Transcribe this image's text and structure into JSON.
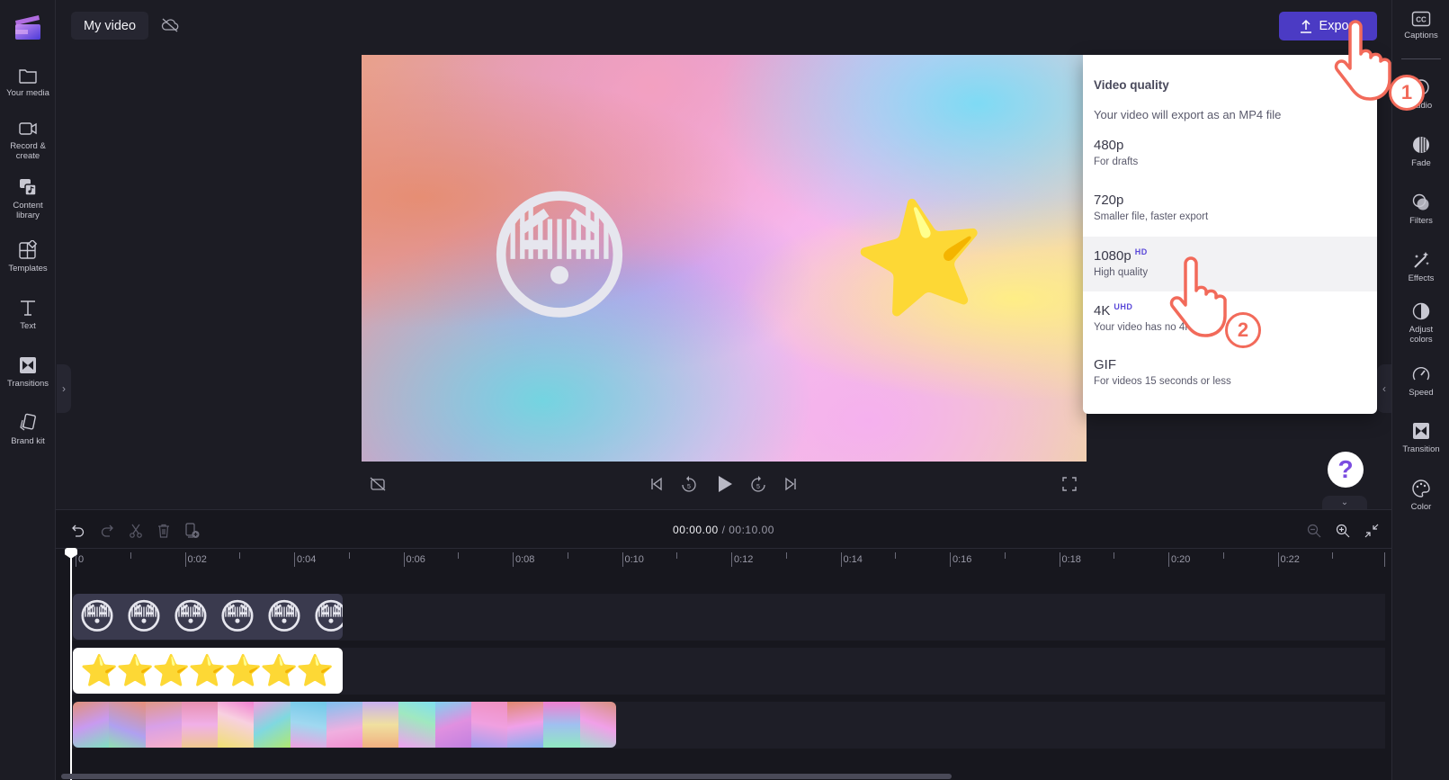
{
  "app": {
    "project_title": "My video",
    "cloud_status_icon": "cloud-off-icon"
  },
  "left_sidebar": {
    "items": [
      {
        "label": "Your media",
        "icon": "folder-icon"
      },
      {
        "label": "Record &\ncreate",
        "icon": "video-camera-icon"
      },
      {
        "label": "Content\nlibrary",
        "icon": "content-library-icon"
      },
      {
        "label": "Templates",
        "icon": "templates-icon"
      },
      {
        "label": "Text",
        "icon": "text-icon"
      },
      {
        "label": "Transitions",
        "icon": "transitions-icon"
      },
      {
        "label": "Brand kit",
        "icon": "brand-kit-icon"
      }
    ]
  },
  "header": {
    "export_label": "Export"
  },
  "preview": {
    "face_emoji": "😳",
    "star_emoji": "⭐"
  },
  "export_menu": {
    "title": "Video quality",
    "subtitle": "Your video will export as an MP4 file",
    "options": [
      {
        "name": "480p",
        "badge": "",
        "desc": "For drafts"
      },
      {
        "name": "720p",
        "badge": "",
        "desc": "Smaller file, faster export"
      },
      {
        "name": "1080p",
        "badge": "HD",
        "desc": "High quality",
        "highlighted": true
      },
      {
        "name": "4K",
        "badge": "UHD",
        "desc": "Your video has no 4K"
      },
      {
        "name": "GIF",
        "badge": "",
        "desc": "For videos 15 seconds or less"
      }
    ]
  },
  "right_sidebar": {
    "items": [
      {
        "label": "Captions",
        "icon": "captions-icon"
      },
      {
        "label": "Audio",
        "icon": "audio-icon"
      },
      {
        "label": "Fade",
        "icon": "fade-icon"
      },
      {
        "label": "Filters",
        "icon": "filters-icon"
      },
      {
        "label": "Effects",
        "icon": "effects-icon"
      },
      {
        "label": "Adjust\ncolors",
        "icon": "adjust-colors-icon"
      },
      {
        "label": "Speed",
        "icon": "speed-icon"
      },
      {
        "label": "Transition",
        "icon": "transition-icon"
      },
      {
        "label": "Color",
        "icon": "color-palette-icon"
      }
    ]
  },
  "help": {
    "label": "?"
  },
  "timeline": {
    "current_time": "00:00.00",
    "total_time": "/ 00:10.00",
    "ruler_labels": [
      "0",
      "0:02",
      "0:04",
      "0:06",
      "0:08",
      "0:10",
      "0:12",
      "0:14",
      "0:16",
      "0:18",
      "0:20",
      "0:22"
    ],
    "tracks": [
      {
        "type": "sticker",
        "emoji": "😳",
        "count": 6
      },
      {
        "type": "sticker",
        "emoji": "⭐",
        "count": 7
      },
      {
        "type": "background",
        "frames": 15
      }
    ]
  },
  "callouts": [
    {
      "number": "1"
    },
    {
      "number": "2"
    }
  ],
  "colors": {
    "accent": "#4b3bc4",
    "hd_badge": "#5a48d8",
    "callout": "#f26a5a",
    "background": "#1c1c24"
  }
}
